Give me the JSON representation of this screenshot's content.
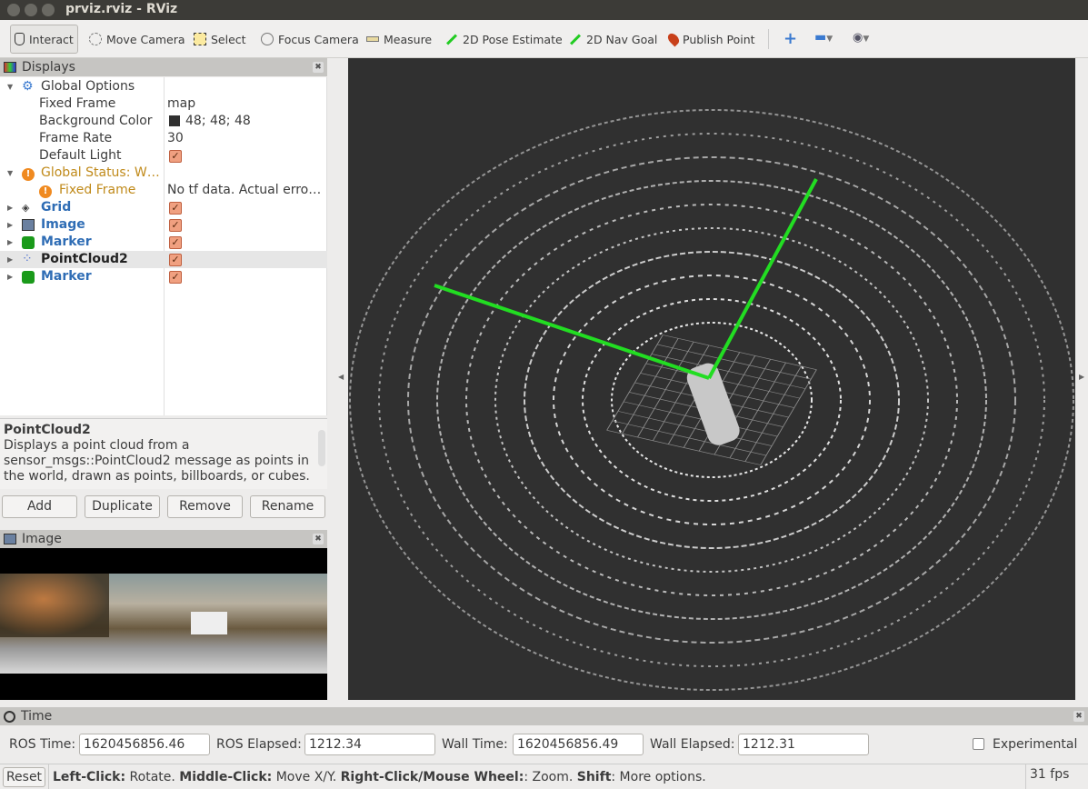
{
  "window": {
    "title": "prviz.rviz - RViz"
  },
  "toolbar": [
    {
      "label": "Interact",
      "icon": "hand-icon"
    },
    {
      "label": "Move Camera",
      "icon": "move-camera-icon"
    },
    {
      "label": "Select",
      "icon": "select-icon"
    },
    {
      "label": "Focus Camera",
      "icon": "focus-camera-icon"
    },
    {
      "label": "Measure",
      "icon": "ruler-icon"
    },
    {
      "label": "2D Pose Estimate",
      "icon": "green-arrow-icon"
    },
    {
      "label": "2D Nav Goal",
      "icon": "green-arrow-icon"
    },
    {
      "label": "Publish Point",
      "icon": "pin-icon"
    }
  ],
  "displays": {
    "title": "Displays",
    "global_options": {
      "label": "Global Options",
      "fixed_frame_label": "Fixed Frame",
      "fixed_frame": "map",
      "bg_label": "Background Color",
      "bg": "48; 48; 48",
      "bg_color": "#303030",
      "fr_label": "Frame Rate",
      "fr": "30",
      "light_label": "Default Light"
    },
    "global_status": {
      "label": "Global Status: W…",
      "fixed_frame_label": "Fixed Frame",
      "fixed_frame_msg": "No tf data.  Actual erro…"
    },
    "items": [
      {
        "label": "Grid"
      },
      {
        "label": "Image"
      },
      {
        "label": "Marker"
      },
      {
        "label": "PointCloud2"
      },
      {
        "label": "Marker"
      }
    ],
    "description": {
      "title": "PointCloud2",
      "text": "Displays a point cloud from a sensor_msgs::PointCloud2 message as points in the world, drawn as points, billboards, or cubes."
    },
    "buttons": {
      "add": "Add",
      "duplicate": "Duplicate",
      "remove": "Remove",
      "rename": "Rename"
    }
  },
  "image_panel": {
    "title": "Image"
  },
  "time": {
    "title": "Time",
    "ros_time_label": "ROS Time:",
    "ros_time": "1620456856.46",
    "ros_elapsed_label": "ROS Elapsed:",
    "ros_elapsed": "1212.34",
    "wall_time_label": "Wall Time:",
    "wall_time": "1620456856.49",
    "wall_elapsed_label": "Wall Elapsed:",
    "wall_elapsed": "1212.31",
    "experimental": "Experimental"
  },
  "status": {
    "reset": "Reset",
    "b1": "Left-Click:",
    "t1": " Rotate. ",
    "b2": "Middle-Click:",
    "t2": " Move X/Y. ",
    "b3": "Right-Click/Mouse Wheel:",
    "t3": ": Zoom. ",
    "b4": "Shift",
    "t4": ": More options.",
    "fps": "31 fps"
  },
  "colors": {
    "accent_green": "#22dd22",
    "viewport_bg": "#303030",
    "link_blue": "#2f6db5",
    "warning": "#c08a1a"
  }
}
